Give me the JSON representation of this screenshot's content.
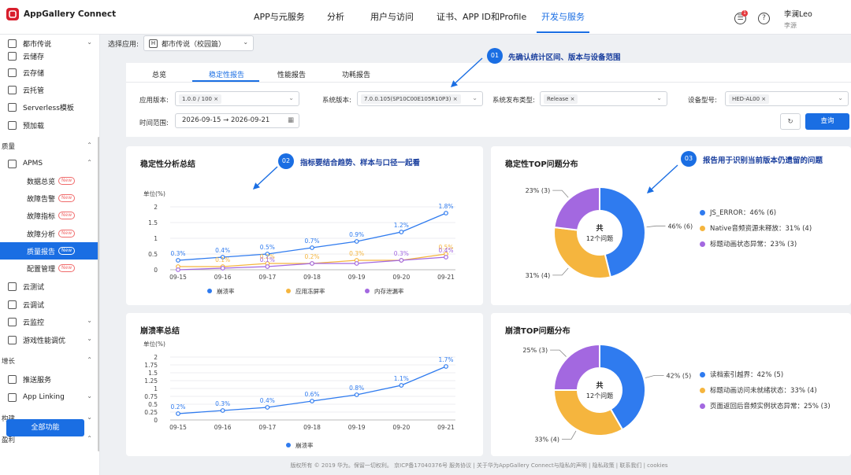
{
  "topbar": {
    "brand": "AppGallery Connect",
    "nav": [
      "APP与元服务",
      "分析",
      "用户与访问",
      "证书、APP ID和Profile",
      "开发与服务"
    ],
    "notification_count": "1",
    "user_name": "李澜Leo",
    "user_sub": "李源"
  },
  "sidebar": {
    "header": "都市传说",
    "items": [
      {
        "label": "云储存",
        "icon": "storage-icon"
      },
      {
        "label": "云存储",
        "icon": "cloud-storage-icon"
      },
      {
        "label": "云托管",
        "icon": "cloud-hosting-icon"
      },
      {
        "label": "Serverless模板",
        "icon": "serverless-icon"
      },
      {
        "label": "预加载",
        "icon": "preload-icon"
      }
    ],
    "section_quality": "质量",
    "apms": "APMS",
    "apms_items": [
      {
        "label": "数据总览",
        "tag": "New"
      },
      {
        "label": "故障告警",
        "tag": "New"
      },
      {
        "label": "故障指标",
        "tag": "New"
      },
      {
        "label": "故障分析",
        "tag": "New"
      },
      {
        "label": "质量报告",
        "tag": "New"
      },
      {
        "label": "配置管理",
        "tag": "New"
      }
    ],
    "items2": [
      {
        "label": "云测试"
      },
      {
        "label": "云调试"
      },
      {
        "label": "云监控"
      },
      {
        "label": "游戏性能调优"
      }
    ],
    "section_growth": "增长",
    "growth_items": [
      {
        "label": "推送服务"
      },
      {
        "label": "App Linking"
      }
    ],
    "section_build": "构建",
    "section_profit": "盈利",
    "all_functions": "全部功能"
  },
  "app_select": {
    "label": "选择应用:",
    "value": "都市传说（校园篇）",
    "icon_letter": "H"
  },
  "tabs": [
    "总览",
    "稳定性报告",
    "性能报告",
    "功耗报告"
  ],
  "filters": {
    "app_version_label": "应用版本:",
    "app_version_value": "1.0.0 / 100",
    "os_version_label": "系统版本:",
    "os_version_value": "7.0.0.105(SP10C00E105R10P3)",
    "release_type_label": "系统发布类型:",
    "release_type_value": "Release",
    "device_label": "设备型号:",
    "device_value": "HED-AL00",
    "time_label": "时间范围:",
    "time_start": "2026-09-15",
    "time_arrow": "→",
    "time_end": "2026-09-21",
    "query": "查询"
  },
  "callouts": [
    {
      "num": "01",
      "text": "先确认统计区间、版本与设备范围"
    },
    {
      "num": "02",
      "text": "指标要结合趋势、样本与口径一起看"
    },
    {
      "num": "03",
      "text": "报告用于识别当前版本仍遗留的问题"
    }
  ],
  "cards": {
    "stability_title": "稳定性分析总结",
    "stability_top_title": "稳定性TOP问题分布",
    "crash_title": "崩溃率总结",
    "crash_top_title": "崩溃TOP问题分布",
    "unit": "单位(%)",
    "donut_center_1": "共",
    "donut_center_2": "12个问题"
  },
  "chart_data": [
    {
      "type": "line",
      "title": "稳定性分析总结",
      "ylabel": "单位(%)",
      "categories": [
        "09-15",
        "09-16",
        "09-17",
        "09-18",
        "09-19",
        "09-20",
        "09-21"
      ],
      "ylim": [
        0,
        2
      ],
      "yticks": [
        0,
        0.5,
        1,
        1.5,
        2
      ],
      "series": [
        {
          "name": "崩溃率",
          "color": "#2f7bef",
          "values": [
            0.3,
            0.4,
            0.5,
            0.7,
            0.9,
            1.2,
            1.8
          ],
          "labels": [
            "0.3%",
            "0.4%",
            "0.5%",
            "0.7%",
            "0.9%",
            "1.2%",
            "1.8%"
          ]
        },
        {
          "name": "应用冻屏率",
          "color": "#f5b53e",
          "values": [
            0.1,
            0.1,
            0.2,
            0.2,
            0.3,
            0.3,
            0.5
          ],
          "labels": [
            "",
            "0.1%",
            "0.2%",
            "0.2%",
            "0.3%",
            "",
            "0.5%"
          ]
        },
        {
          "name": "内存泄漏率",
          "color": "#a368e0",
          "values": [
            0.0,
            0.05,
            0.1,
            0.2,
            0.2,
            0.3,
            0.4
          ],
          "labels": [
            "",
            "",
            "0.1%",
            "",
            "",
            "0.3%",
            "0.4%"
          ]
        }
      ]
    },
    {
      "type": "pie",
      "title": "稳定性TOP问题分布",
      "series": [
        {
          "name": "JS_ERROR",
          "value": 6,
          "percent": 46,
          "color": "#2f7bef",
          "legend": "JS_ERROR：46% (6)",
          "label": "46% (6)"
        },
        {
          "name": "Native音频资源未释放",
          "value": 4,
          "percent": 31,
          "color": "#f5b53e",
          "legend": "Native音频资源未释放：31% (4)",
          "label": "31% (4)"
        },
        {
          "name": "标题动画状态异常",
          "value": 3,
          "percent": 23,
          "color": "#a368e0",
          "legend": "标题动画状态异常：23% (3)",
          "label": "23% (3)"
        }
      ]
    },
    {
      "type": "line",
      "title": "崩溃率总结",
      "ylabel": "单位(%)",
      "categories": [
        "09-15",
        "09-16",
        "09-17",
        "09-18",
        "09-19",
        "09-20",
        "09-21"
      ],
      "ylim": [
        0,
        2
      ],
      "yticks": [
        0,
        0.25,
        0.5,
        0.75,
        1,
        1.25,
        1.5,
        1.75,
        2
      ],
      "ytick_labels": [
        "0",
        "0.25",
        "0.5",
        "0.75",
        "1",
        "1.25",
        "1.5",
        "1.75",
        "2"
      ],
      "series": [
        {
          "name": "崩溃率",
          "color": "#2f7bef",
          "values": [
            0.2,
            0.3,
            0.4,
            0.6,
            0.8,
            1.1,
            1.7
          ],
          "labels": [
            "0.2%",
            "0.3%",
            "0.4%",
            "0.6%",
            "0.8%",
            "1.1%",
            "1.7%"
          ]
        }
      ]
    },
    {
      "type": "pie",
      "title": "崩溃TOP问题分布",
      "series": [
        {
          "name": "读档索引越界",
          "value": 5,
          "percent": 42,
          "color": "#2f7bef",
          "legend": "读档索引越界：42% (5)",
          "label": "42% (5)"
        },
        {
          "name": "标题动画访问未就绪状态",
          "value": 4,
          "percent": 33,
          "color": "#f5b53e",
          "legend": "标题动画访问未就绪状态：33% (4)",
          "label": "33% (4)"
        },
        {
          "name": "页面返回后音频实例状态异常",
          "value": 3,
          "percent": 25,
          "color": "#a368e0",
          "legend": "页面返回后音频实例状态异常：25% (3)",
          "label": "25% (3)"
        }
      ]
    }
  ],
  "footer": "版权所有 © 2019 华为。保留一切权利。 京ICP备17040376号    服务协议  |  关于华为AppGallery Connect与隐私的声明  |  隐私政策  |  联系我们  |  cookies"
}
